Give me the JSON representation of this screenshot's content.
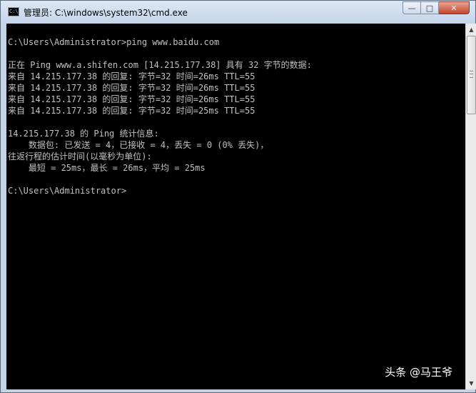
{
  "window": {
    "title": "管理员: C:\\windows\\system32\\cmd.exe",
    "icon": "cmd-console-icon",
    "icon_label": "C:\\",
    "buttons": {
      "minimize": "—",
      "maximize": "□",
      "close": "✕"
    }
  },
  "console": {
    "lines": [
      "",
      "C:\\Users\\Administrator>ping www.baidu.com",
      "",
      "正在 Ping www.a.shifen.com [14.215.177.38] 具有 32 字节的数据:",
      "来自 14.215.177.38 的回复: 字节=32 时间=26ms TTL=55",
      "来自 14.215.177.38 的回复: 字节=32 时间=26ms TTL=55",
      "来自 14.215.177.38 的回复: 字节=32 时间=26ms TTL=55",
      "来自 14.215.177.38 的回复: 字节=32 时间=25ms TTL=55",
      "",
      "14.215.177.38 的 Ping 统计信息:",
      "    数据包: 已发送 = 4，已接收 = 4，丢失 = 0 (0% 丢失)，",
      "往返行程的估计时间(以毫秒为单位):",
      "    最短 = 25ms，最长 = 26ms，平均 = 25ms",
      "",
      "C:\\Users\\Administrator>"
    ]
  },
  "scrollbar": {
    "up_arrow": "▲",
    "down_arrow": "▼"
  },
  "watermark": {
    "text": "头条 @马王爷"
  },
  "colors": {
    "console_background": "#000000",
    "console_text": "#c0c0c0",
    "titlebar": "#c4d5ea",
    "close_button": "#c7452c"
  }
}
